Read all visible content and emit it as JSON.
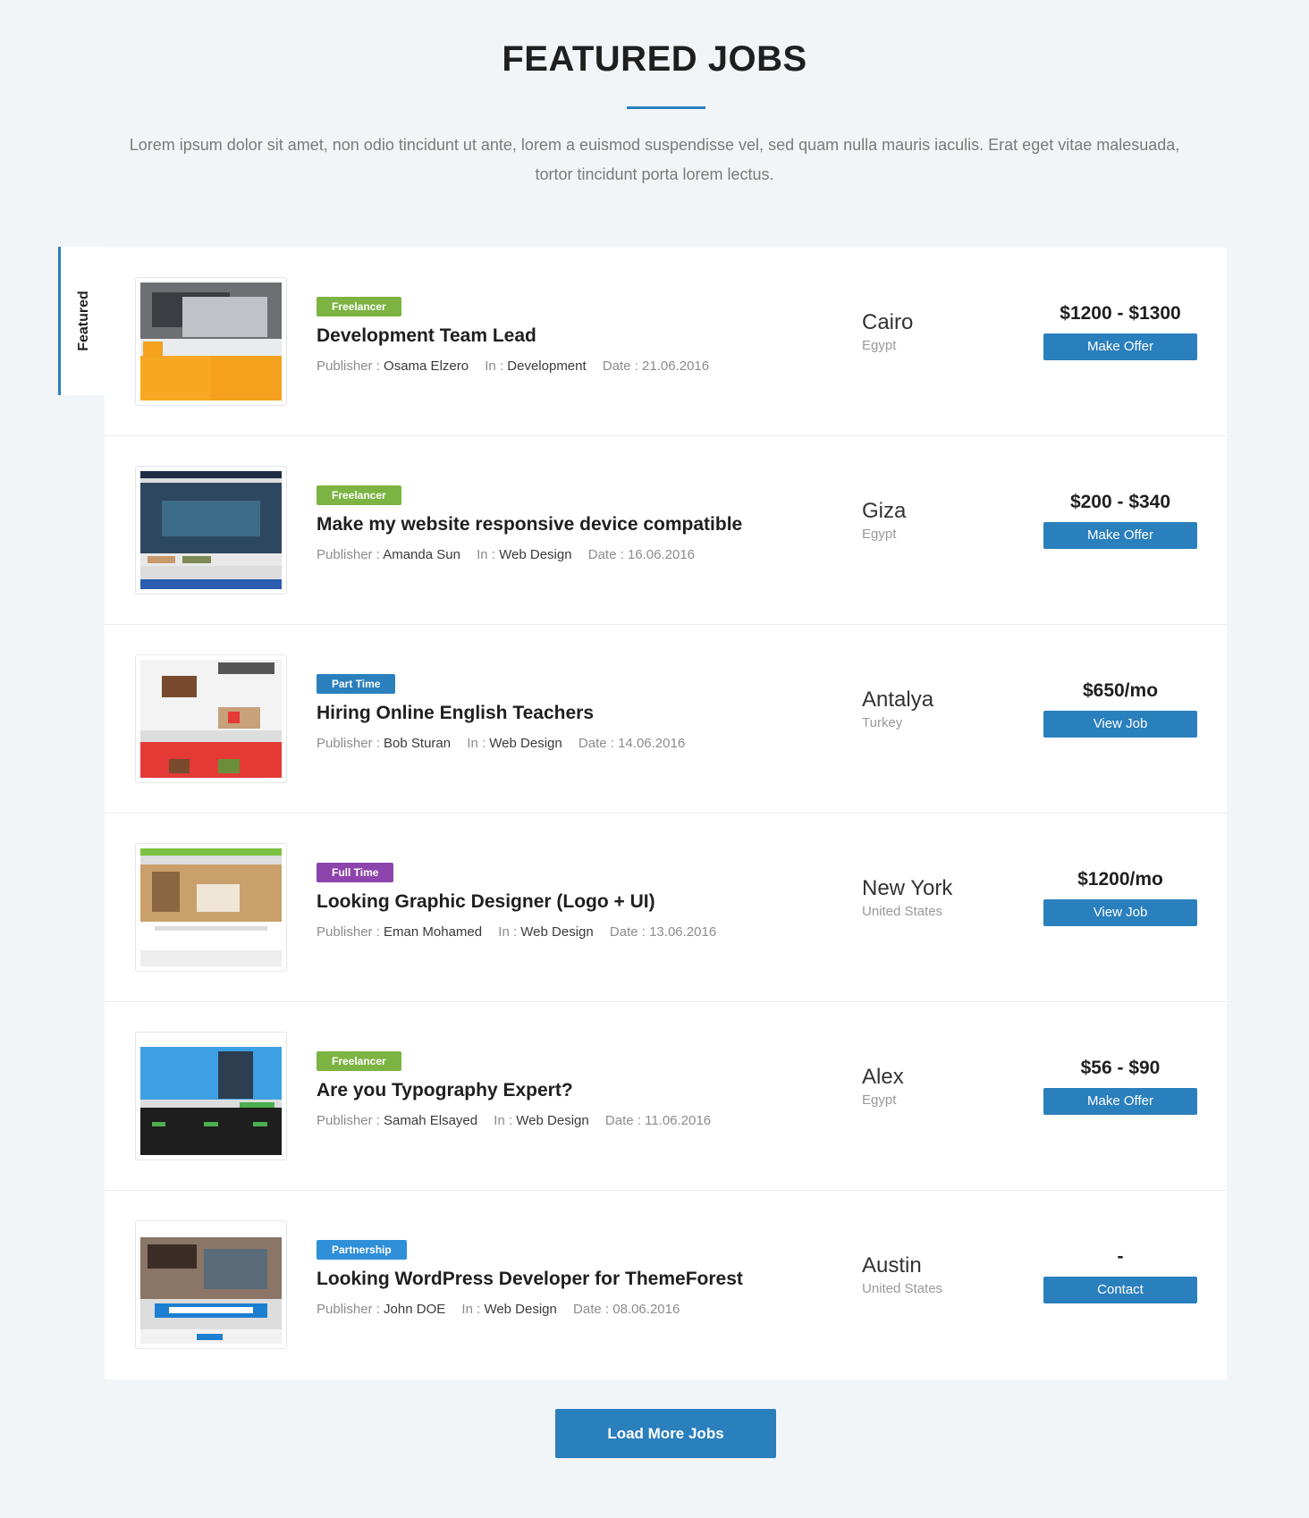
{
  "header": {
    "title": "FEATURED JOBS",
    "intro": "Lorem ipsum dolor sit amet, non odio tincidunt ut ante, lorem a euismod suspendisse vel, sed quam nulla mauris iaculis. Erat eget vitae malesuada, tortor tincidunt porta lorem lectus."
  },
  "featured_tab": {
    "label": "Featured"
  },
  "colors": {
    "accent": "#2a7fbd",
    "freelancer": "#7cb342",
    "part_time": "#2a7fbd",
    "full_time": "#8e44ad",
    "partnership": "#2f8fd8"
  },
  "labels": {
    "publisher": "Publisher : ",
    "in": "In : ",
    "date": "Date : "
  },
  "jobs": [
    {
      "badge": "Freelancer",
      "badge_color": "#7cb342",
      "title": "Development Team Lead",
      "publisher": "Osama Elzero",
      "category": "Development",
      "date": "21.06.2016",
      "city": "Cairo",
      "country": "Egypt",
      "price": "$1200 - $1300",
      "action": "Make Offer",
      "thumb": "laptop-website-mockup"
    },
    {
      "badge": "Freelancer",
      "badge_color": "#7cb342",
      "title": "Make my website responsive device compatible",
      "publisher": "Amanda Sun",
      "category": "Web Design",
      "date": "16.06.2016",
      "city": "Giza",
      "country": "Egypt",
      "price": "$200 - $340",
      "action": "Make Offer",
      "thumb": "travel-website-mockup"
    },
    {
      "badge": "Part Time",
      "badge_color": "#2a7fbd",
      "title": "Hiring Online English Teachers",
      "publisher": "Bob Sturan",
      "category": "Web Design",
      "date": "14.06.2016",
      "city": "Antalya",
      "country": "Turkey",
      "price": "$650/mo",
      "action": "View Job",
      "thumb": "restaurant-website-mockup"
    },
    {
      "badge": "Full Time",
      "badge_color": "#8e44ad",
      "title": "Looking Graphic Designer (Logo + UI)",
      "publisher": "Eman Mohamed",
      "category": "Web Design",
      "date": "13.06.2016",
      "city": "New York",
      "country": "United States",
      "price": "$1200/mo",
      "action": "View Job",
      "thumb": "interior-website-mockup"
    },
    {
      "badge": "Freelancer",
      "badge_color": "#7cb342",
      "title": "Are you Typography Expert?",
      "publisher": "Samah Elsayed",
      "category": "Web Design",
      "date": "11.06.2016",
      "city": "Alex",
      "country": "Egypt",
      "price": "$56 - $90",
      "action": "Make Offer",
      "thumb": "business-website-mockup"
    },
    {
      "badge": "Partnership",
      "badge_color": "#2f8fd8",
      "title": "Looking WordPress Developer for ThemeForest",
      "publisher": "John DOE",
      "category": "Web Design",
      "date": "08.06.2016",
      "city": "Austin",
      "country": "United States",
      "price": "-",
      "action": "Contact",
      "thumb": "corporate-website-mockup"
    }
  ],
  "load_more": "Load More Jobs"
}
